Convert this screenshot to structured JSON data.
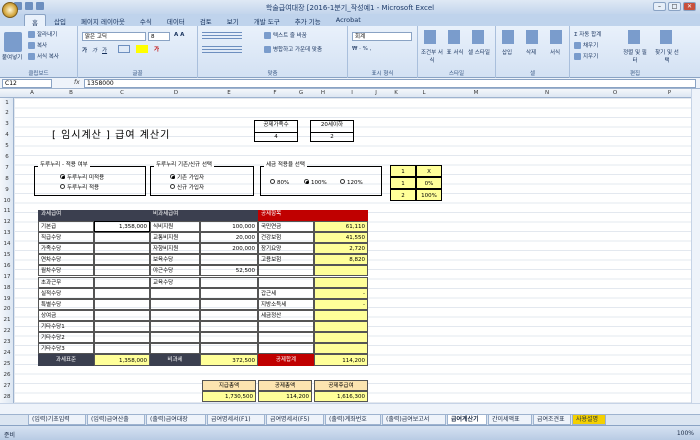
{
  "window": {
    "title": "학술급여대장 [2016-1분기_작성예1 - Microsoft Excel"
  },
  "ribbon_tabs": [
    "홈",
    "삽입",
    "페이지 레이아웃",
    "수식",
    "데이터",
    "검토",
    "보기",
    "개발 도구",
    "추가 기능",
    "Acrobat"
  ],
  "ribbon": {
    "paste": "붙여넣기",
    "cut": "잘라내기",
    "copy": "복사",
    "format_painter": "서식 복사",
    "font_name": "맑은 고딕",
    "font_size": "8",
    "wrap_text": "텍스트 줄 바꿈",
    "merge_center": "병합하고 가운데 맞춤",
    "number_format": "회계",
    "cond_format": "조건부 서식",
    "table_format": "표 서식",
    "cell_style": "셀 스타일",
    "insert": "삽입",
    "delete": "삭제",
    "format": "서식",
    "autosum": "자동 합계",
    "fill": "채우기",
    "clear": "지우기",
    "sort_filter": "정렬 및 필터",
    "find_select": "찾기 및 선택",
    "groups": [
      "클립보드",
      "글꼴",
      "맞춤",
      "표시 형식",
      "스타일",
      "셀",
      "편집"
    ]
  },
  "formula_bar": {
    "name_box": "C12",
    "fx": "fx",
    "value": "1358000"
  },
  "columns": [
    "A",
    "B",
    "C",
    "D",
    "E",
    "F",
    "G",
    "H",
    "I",
    "J",
    "K",
    "L",
    "M",
    "N",
    "O",
    "P"
  ],
  "rows": [
    "1",
    "2",
    "3",
    "4",
    "5",
    "6",
    "7",
    "8",
    "9",
    "10",
    "11",
    "12",
    "13",
    "14",
    "15",
    "16",
    "17",
    "18",
    "19",
    "20",
    "21",
    "22",
    "23",
    "24",
    "25",
    "26",
    "27",
    "28"
  ],
  "sheet": {
    "title": "[ 임시계산 ]  급여 계산기",
    "family_label": "공제가족수",
    "family_value": "4",
    "under20_label": "20세이하",
    "under20_value": "2",
    "dup_label": "두루누리 - 적용 여부",
    "dup_opt1": "두루누리 미적용",
    "dup_opt2": "두루누리 적용",
    "dup_basis_label": "두루누리 기존/신규 선택",
    "dup_basis_opt1": "기존 가입자",
    "dup_basis_opt2": "신규 가입자",
    "tax_label": "세금 적용율 선택",
    "tax_opt1": "80%",
    "tax_opt2": "100%",
    "tax_opt3": "120%",
    "side_table": [
      [
        "1",
        "X"
      ],
      [
        "1",
        "0%"
      ],
      [
        "2",
        "100%"
      ]
    ],
    "taxable_header": "과세급여",
    "nontax_header": "비과세급여",
    "deduction_header": "공제항목",
    "taxable_items": [
      "기본급",
      "직급수당",
      "가족수당",
      "연차수당",
      "월차수당",
      "초과근무",
      "실적수당",
      "특별수당",
      "상여금",
      "기타수당1",
      "기타수당2",
      "기타수당3"
    ],
    "taxable_values": [
      "1,358,000",
      "",
      "",
      "",
      "",
      "",
      "",
      "",
      "",
      "",
      "",
      ""
    ],
    "nontax_items": [
      "식비지원",
      "교통비지원",
      "자향비지원",
      "보육수당",
      "야근수당",
      "교육수당",
      "",
      "",
      "",
      "",
      "",
      ""
    ],
    "nontax_values": [
      "100,000",
      "20,000",
      "200,000",
      "",
      "52,500",
      "",
      "",
      "",
      "",
      "",
      "",
      ""
    ],
    "deduction_items": [
      "국민연금",
      "건강보험",
      "장기요양",
      "고용보험",
      "",
      "",
      "갑근세",
      "지방소득세",
      "세금정산",
      "",
      "",
      ""
    ],
    "deduction_values": [
      "61,110",
      "41,550",
      "2,720",
      "8,820",
      "",
      "",
      "-",
      "-",
      "",
      "",
      "",
      ""
    ],
    "taxable_total_label": "과세표준",
    "taxable_total": "1,358,000",
    "nontax_total_label": "비과세",
    "nontax_total": "372,500",
    "deduction_total_label": "공제합계",
    "deduction_total": "114,200",
    "summary_headers": [
      "지급총액",
      "공제총액",
      "공제후급여"
    ],
    "summary_values": [
      "1,730,500",
      "114,200",
      "1,616,300"
    ]
  },
  "sheet_tabs": [
    "(입력)기초입력",
    "(입력)급여산출",
    "(출력)급여대장",
    "급여명세서(F1)",
    "급여명세서(F5)",
    "(출력)계좌번호",
    "(출력)급여보고서",
    "급여계산기",
    "간이세액표",
    "급여조견표",
    "사용설명"
  ],
  "active_sheet": "급여계산기",
  "status": {
    "ready": "준비",
    "zoom": "100%"
  }
}
